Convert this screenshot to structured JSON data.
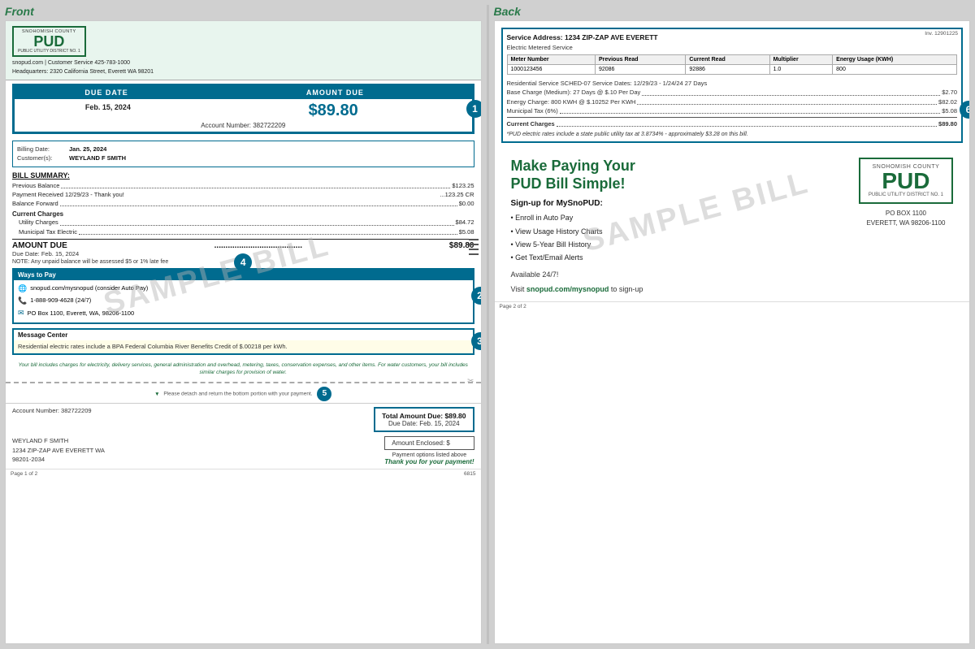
{
  "labels": {
    "front": "Front",
    "back": "Back"
  },
  "front": {
    "pud": {
      "snohomish": "SNOHOMISH COUNTY",
      "name": "PUD",
      "subtitle": "PUBLIC UTILITY DISTRICT NO. 1"
    },
    "contact": {
      "line1": "snopud.com | Customer Service 425-783-1000",
      "line2": "Headquarters: 2320 California Street, Everett WA 98201"
    },
    "due_box": {
      "due_date_label": "DUE DATE",
      "amount_due_label": "AMOUNT DUE",
      "due_date": "Feb. 15, 2024",
      "amount": "$89.80",
      "account_label": "Account Number: 382722209",
      "badge": "1"
    },
    "billing_info": {
      "billing_date_label": "Billing Date:",
      "billing_date": "Jan. 25, 2024",
      "customers_label": "Customer(s):",
      "customer": "WEYLAND F SMITH"
    },
    "bill_summary": {
      "title": "BILL SUMMARY:",
      "previous_balance_label": "Previous Balance",
      "previous_balance": "$123.25",
      "payment_label": "Payment Received 12/29/23 - Thank you!",
      "payment": "...123.25 CR",
      "balance_label": "Balance Forward",
      "balance": "$0.00",
      "current_charges_header": "Current Charges",
      "utility_label": "Utility Charges",
      "utility": "$84.72",
      "municipal_label": "Municipal Tax Electric",
      "municipal": "$5.08",
      "amount_due_label": "AMOUNT DUE",
      "amount_due_dots": ".....................................",
      "amount_due": "$89.80",
      "due_date_label": "Due Date: Feb. 15, 2024",
      "note": "NOTE:  Any unpaid balance will be assessed $5 or 1% late fee",
      "badge": "4"
    },
    "ways_to_pay": {
      "header": "Ways to Pay",
      "item1": "snopud.com/mysnopud (consider Auto Pay)",
      "item2": "1-888-909-4628 (24/7)",
      "item3": "PO Box 1100, Everett, WA, 98206-1100",
      "badge": "2"
    },
    "message_center": {
      "header": "Message Center",
      "text": "Residential electric rates include a BPA Federal Columbia River Benefits Credit of $.00218 per kWh.",
      "badge": "3"
    },
    "watermark": "SAMPLE BILL",
    "tear_note": "Please detach and return the bottom portion with your payment.",
    "italic_note": "Your bill includes charges for electricity, delivery services, general administration and overhead, metering, taxes, conservation expenses, and other items. For water customers, your bill includes similar charges for provision of water.",
    "stub": {
      "account": "Account Number: 382722209",
      "total_label": "Total Amount Due: $89.80",
      "due_date": "Due Date: Feb. 15, 2024",
      "address_line1": "WEYLAND F SMITH",
      "address_line2": "1234 ZIP-ZAP AVE EVERETT WA",
      "address_line3": "98201-2034",
      "amount_enclosed": "Amount Enclosed: $",
      "payment_options": "Payment options listed above",
      "thank_you": "Thank you for your payment!"
    },
    "footer": {
      "left": "Page 1 of 2",
      "right": "6815"
    }
  },
  "back": {
    "invoice_num": "Inv. 12901225",
    "service_address_label": "Service Address: 1234 ZIP-ZAP AVE     EVERETT",
    "electric_service": "Electric Metered Service",
    "meter_table": {
      "headers": [
        "Meter Number",
        "Previous Read",
        "Current Read",
        "Multiplier",
        "Energy Usage (KWH)"
      ],
      "rows": [
        [
          "1000123456",
          "92086",
          "92886",
          "1.0",
          "800"
        ]
      ]
    },
    "residential": {
      "service_info": "Residential Service    SCHED-07   Service Dates: 12/29/23 - 1/24/24   27 Days",
      "base_label": "Base Charge (Medium): 27 Days @ $.10 Per Day",
      "base_value": "$2.70",
      "energy_label": "Energy Charge: 800 KWH @ $.10252 Per KWH",
      "energy_value": "$82.02",
      "tax_label": "Municipal Tax (6%)",
      "tax_value": "$5.08",
      "current_charges_label": "Current Charges",
      "current_charges_value": "$89.80"
    },
    "tax_note": "*PUD electric rates include a state public utility tax at 3.8734% - approximately $3.28 on this bill.",
    "badge": "6",
    "make_paying": {
      "title_line1": "Make Paying Your",
      "title_line2": "PUD Bill Simple!",
      "signup_header": "Sign-up for MySnoPUD:",
      "items": [
        "Enroll in Auto Pay",
        "View Usage History Charts",
        "View 5-Year Bill History",
        "Get Text/Email Alerts"
      ],
      "available": "Available 24/7!",
      "visit_text": "Visit snopud.com/mysnopud to sign-up"
    },
    "pud_logo": {
      "snohomish": "SNOHOMISH COUNTY",
      "name": "PUD",
      "subtitle": "Public Utility District No. 1"
    },
    "pud_address": {
      "line1": "PO BOX 1100",
      "line2": "EVERETT, WA 98206-1100"
    },
    "footer": {
      "left": "Page 2 of 2"
    }
  }
}
